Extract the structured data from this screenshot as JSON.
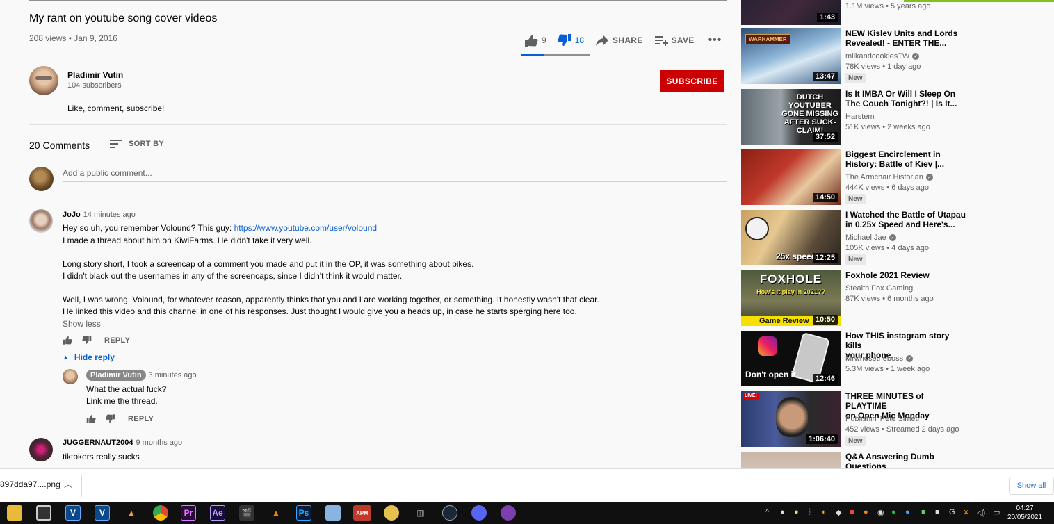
{
  "video": {
    "title": "My rant on youtube song cover videos",
    "meta": "208 views • Jan 9, 2016",
    "likes": "9",
    "dislikes": "18",
    "share_label": "SHARE",
    "save_label": "SAVE",
    "like_ratio": 0.33
  },
  "channel": {
    "name": "Pladimir Vutin",
    "subscribers": "104 subscribers",
    "subscribe_label": "SUBSCRIBE",
    "description": "Like, comment, subscribe!"
  },
  "comments_section": {
    "count_label": "20 Comments",
    "sort_label": "SORT BY",
    "add_placeholder": "Add a public comment..."
  },
  "comments": [
    {
      "author": "JoJo",
      "time": "14 minutes ago",
      "line1_prefix": "Hey so uh, you remember Volound? This guy: ",
      "line1_link": "https://www.youtube.com/user/volound",
      "line2": "I made a thread about him on KiwiFarms. He didn't take it very well.",
      "line3": "Long story short, I took a screencap of a comment you made and put it in the OP, it was something about pikes.",
      "line4": "I didn't black out the usernames in any of the screencaps, since I didn't think it would matter.",
      "line5": "Well, I was wrong. Volound, for whatever reason, apparently thinks that you and I are working together, or something. It honestly wasn't that clear.",
      "line6": "He linked this video and this channel in one of his responses. Just thought I would give you a heads up, in case he starts sperging here too.",
      "show_less": "Show less",
      "reply_label": "REPLY",
      "hide_reply": "Hide reply"
    },
    {
      "author": "Pladimir Vutin",
      "time": "3 minutes ago",
      "line1": "What the actual fuck?",
      "line2": "Link me the thread.",
      "reply_label": "REPLY"
    },
    {
      "author": "JUGGERNAUT2004",
      "time": "9 months ago",
      "line1": "tiktokers really sucks"
    }
  ],
  "sidebar": {
    "top_partial": {
      "duration": "1:43",
      "views": "1.1M views • 5 years ago"
    },
    "items": [
      {
        "title1": "NEW Kislev Units and Lords",
        "title2": "Revealed! - ENTER THE...",
        "channel": "milkandcookiesTW",
        "verified": true,
        "views": "78K views • 1 day ago",
        "badge": "New",
        "duration": "13:47",
        "thumb_text": "WARHAMMER"
      },
      {
        "title1": "Is It IMBA Or Will I Sleep On",
        "title2": "The Couch Tonight?! | Is It...",
        "channel": "Harstem",
        "verified": false,
        "views": "51K views • 2 weeks ago",
        "badge": "",
        "duration": "37:52",
        "thumb_text": "DUTCH YOUTUBER GONE MISSING AFTER SUCK-CLAIM!"
      },
      {
        "title1": "Biggest Encirclement in",
        "title2": "History: Battle of Kiev |...",
        "channel": "The Armchair Historian",
        "verified": true,
        "views": "444K views • 6 days ago",
        "badge": "New",
        "duration": "14:50",
        "thumb_text": ""
      },
      {
        "title1": "I Watched the Battle of Utapau",
        "title2": "in 0.25x Speed and Here's...",
        "channel": "Michael Jae",
        "verified": true,
        "views": "105K views • 4 days ago",
        "badge": "New",
        "duration": "12:25",
        "thumb_text": "25x speed"
      },
      {
        "title1": "Foxhole 2021 Review",
        "title2": "",
        "channel": "Stealth Fox Gaming",
        "verified": false,
        "views": "87K views • 6 months ago",
        "badge": "",
        "duration": "10:50",
        "thumb_text": "FOXHOLE",
        "thumb_sub": "How's it play in 2021??",
        "thumb_bottom": "Game Review"
      },
      {
        "title1": "How THIS instagram story kills",
        "title2": "your phone.",
        "channel": "Mrwhosetheboss",
        "verified": true,
        "views": "5.3M views • 1 week ago",
        "badge": "",
        "duration": "12:46",
        "thumb_text": "Don't open it."
      },
      {
        "title1": "THREE MINUTES of PLAYTIME",
        "title2": "on Open Mic Monday",
        "channel": "Publishin' Pete Simeti",
        "verified": false,
        "views": "452 views • Streamed 2 days ago",
        "badge": "New",
        "duration": "1:06:40",
        "thumb_text": "LIVE!"
      },
      {
        "title1": "Q&A Answering Dumb",
        "title2": "Questions",
        "channel": "",
        "verified": false,
        "views": "",
        "badge": "",
        "duration": "",
        "thumb_text": ""
      }
    ]
  },
  "downloads": {
    "file": "897dda97....png",
    "show_all": "Show all"
  },
  "taskbar": {
    "time": "04:27",
    "date": "20/05/2021",
    "apps": [
      "file-explorer",
      "media",
      "V",
      "V",
      "app",
      "chrome",
      "Pr",
      "Ae",
      "clapper",
      "vlc",
      "Ps",
      "image",
      "APM",
      "emoji",
      "equalizer",
      "steam",
      "discord",
      "tor"
    ]
  }
}
